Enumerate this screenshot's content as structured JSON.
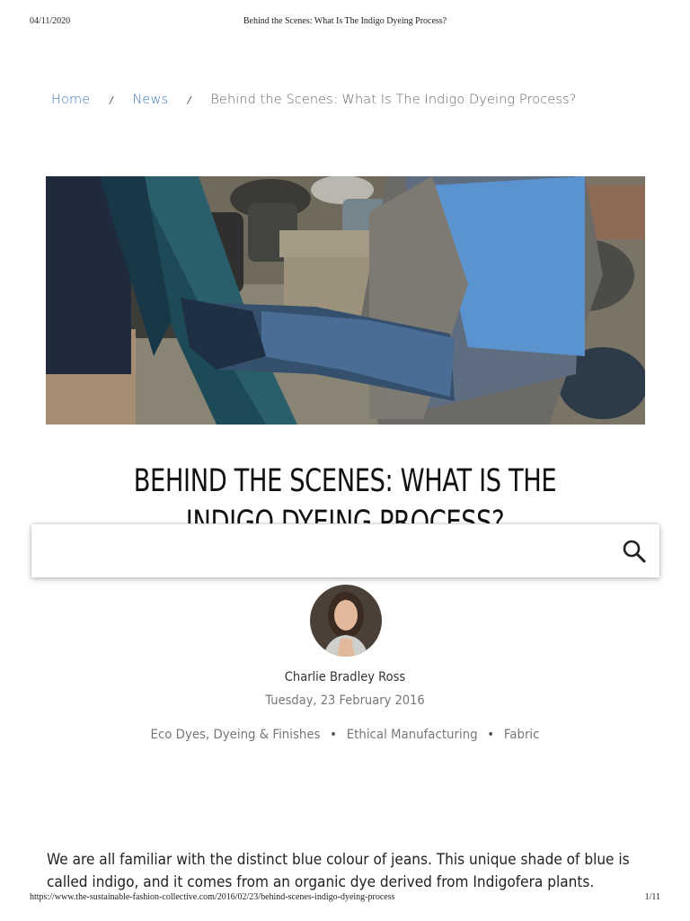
{
  "print_header": {
    "date": "04/11/2020",
    "title": "Behind the Scenes: What Is The Indigo Dyeing Process?"
  },
  "breadcrumb": {
    "home": "Home",
    "separator": "/",
    "news": "News",
    "current": "Behind the Scenes: What Is The Indigo Dyeing Process?"
  },
  "article": {
    "title": "Behind the Scenes: What Is The Indigo Dyeing Process?",
    "author": "Charlie Bradley Ross",
    "date": "Tuesday, 23 February 2016",
    "categories": [
      "Eco Dyes, Dyeing & Finishes",
      "Ethical Manufacturing",
      "Fabric"
    ],
    "category_separator": "•",
    "intro": "We are all familiar with the distinct blue colour of jeans. This unique shade of blue is called indigo, and it comes from an organic dye derived from Indigofera plants."
  },
  "search": {
    "value": "",
    "icon": "search-icon"
  },
  "print_footer": {
    "url": "https://www.the-sustainable-fashion-collective.com/2016/02/23/behind-scenes-indigo-dyeing-process",
    "page": "1/11"
  },
  "colors": {
    "link": "#3d7ab8",
    "indigo": "#2b4a6b"
  }
}
